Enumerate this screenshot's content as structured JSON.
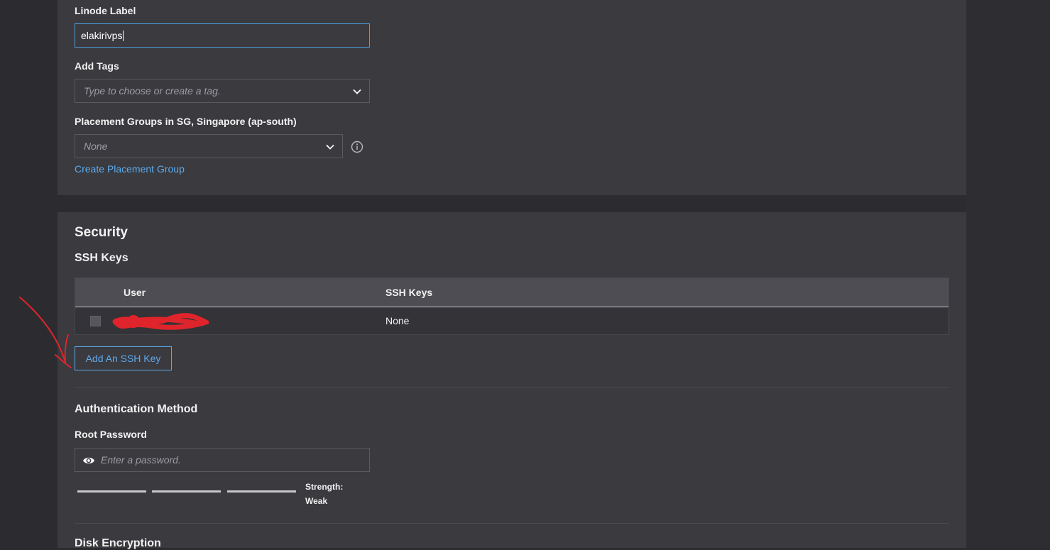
{
  "details": {
    "linode_label": {
      "label": "Linode Label",
      "value": "elakirivps"
    },
    "tags": {
      "label": "Add Tags",
      "placeholder": "Type to choose or create a tag."
    },
    "placement_groups": {
      "label": "Placement Groups in SG, Singapore (ap-south)",
      "placeholder": "None",
      "link": "Create Placement Group"
    }
  },
  "security": {
    "title": "Security",
    "ssh_keys": {
      "title": "SSH Keys",
      "columns": [
        "User",
        "SSH Keys"
      ],
      "rows": [
        {
          "user": "",
          "keys": "None"
        }
      ],
      "add_button": "Add An SSH Key"
    },
    "auth": {
      "title": "Authentication Method",
      "root_password": {
        "label": "Root Password",
        "placeholder": "Enter a password."
      },
      "strength_label": "Strength:",
      "strength_value": "Weak"
    },
    "disk_encryption": {
      "title": "Disk Encryption"
    }
  },
  "colors": {
    "accent": "#5ea9eb",
    "focus": "#4d9fde",
    "annotation": "#e0242b"
  },
  "icons": [
    "chevron-down-icon",
    "info-icon",
    "eye-icon"
  ]
}
